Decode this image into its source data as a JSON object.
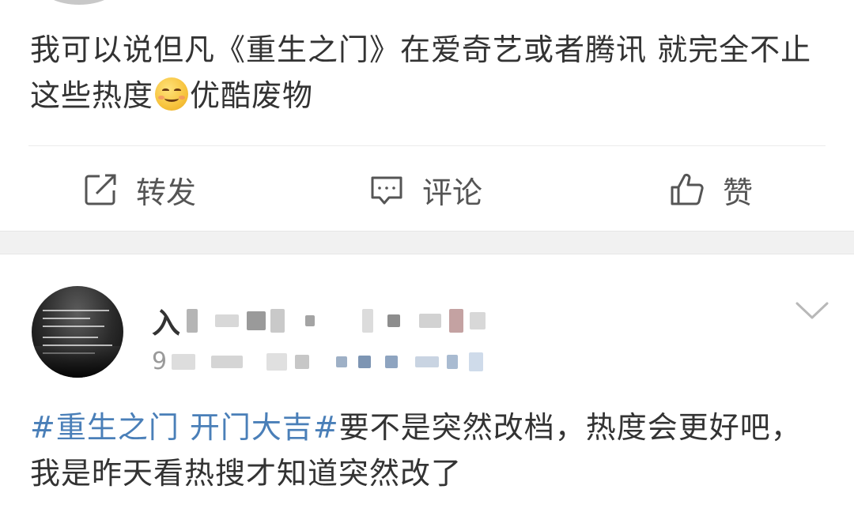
{
  "post1": {
    "text_part1": "我可以说但凡《重生之门》在爱奇艺或者腾讯 就完全不止这些热度",
    "emoji": "smile-emoji",
    "text_part2": "优酷废物"
  },
  "actions": {
    "repost_label": "转发",
    "comment_label": "评论",
    "like_label": "赞",
    "repost_icon": "share-icon",
    "comment_icon": "comment-icon",
    "like_icon": "thumbs-up-icon"
  },
  "post2": {
    "username_visible": "入",
    "meta_visible": "9",
    "hashtag": "#重生之门 开门大吉#",
    "body": "要不是突然改档，热度会更好吧，我是昨天看热搜才知道突然改了",
    "menu_icon": "chevron-down-icon"
  },
  "colors": {
    "text": "#333333",
    "hashtag": "#4a7fb8",
    "separator": "#f1f1f1",
    "meta": "#9a9a9a"
  }
}
